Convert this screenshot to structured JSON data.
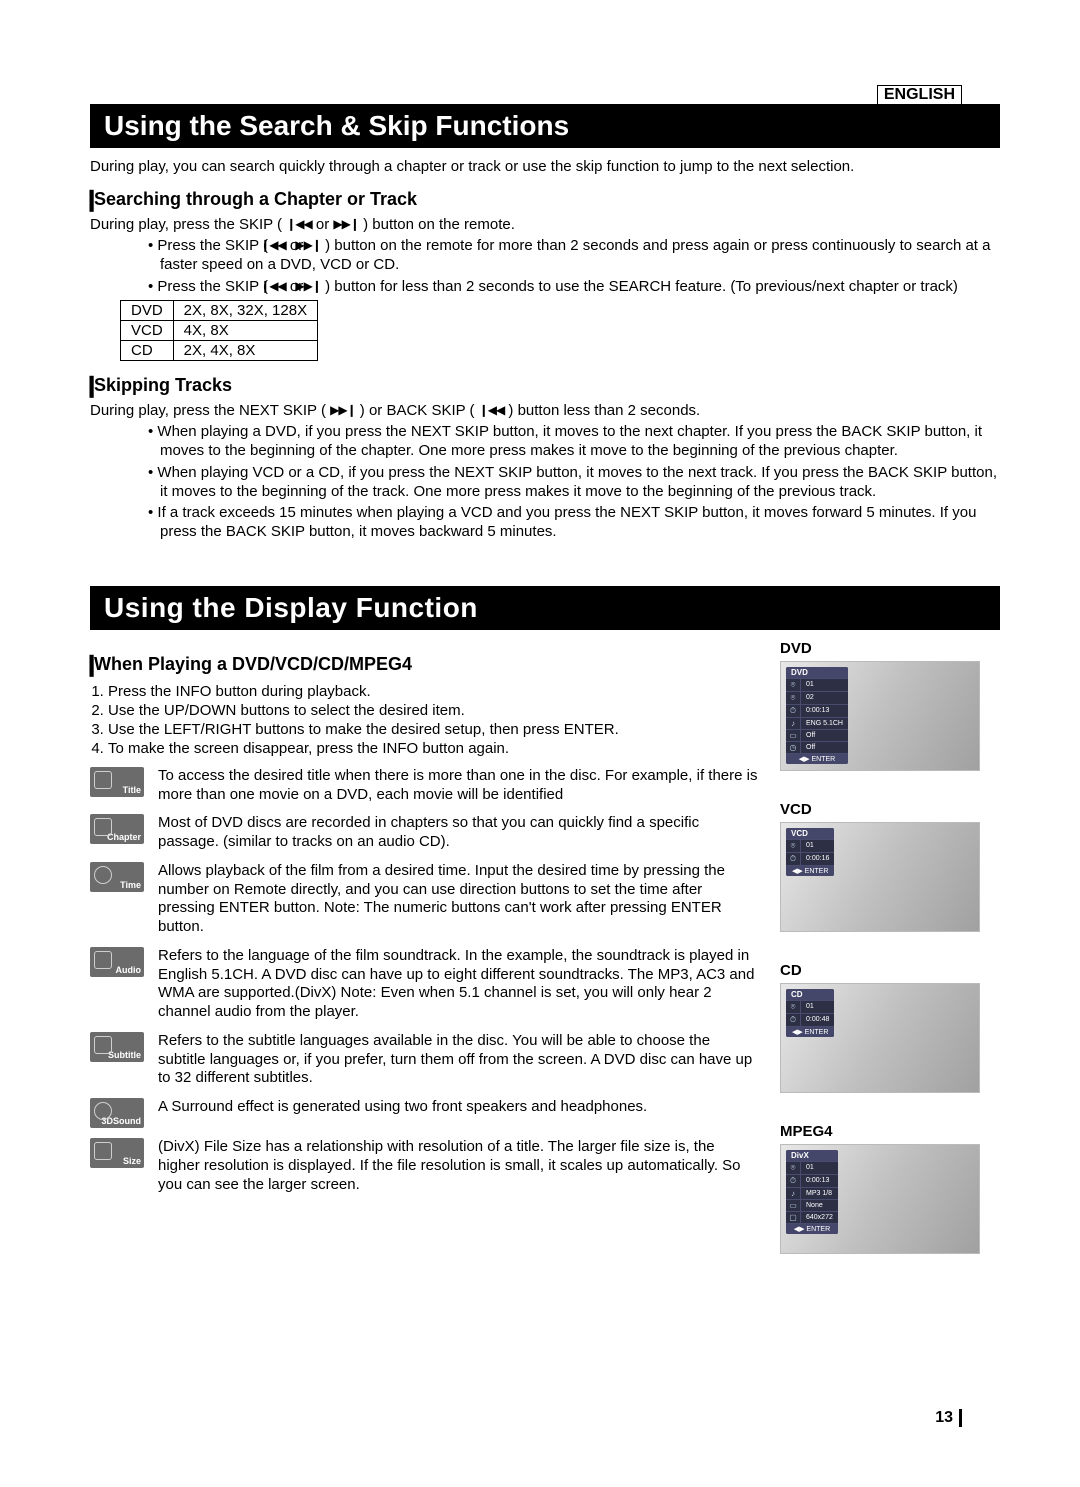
{
  "lang_label": "ENGLISH",
  "page_number": "13",
  "section1": {
    "heading": "Using the Search & Skip Functions",
    "intro": "During play, you can search quickly through a chapter or track or use the skip function to jump to the next selection.",
    "sub1": {
      "heading": "Searching through a Chapter or Track",
      "line": "During play, press the SKIP (",
      "line_mid": " or ",
      "line_end": " ) button on the remote.",
      "bullet1a": "Press the SKIP (",
      "bullet1b": " or ",
      "bullet1c": " ) button on the remote for more than 2 seconds and press again or press continuously to search at a faster speed on a DVD, VCD or CD.",
      "bullet2a": "Press the SKIP (",
      "bullet2b": " or ",
      "bullet2c": " ) button for less than 2 seconds to use the SEARCH feature. (To previous/next chapter or track)",
      "table": [
        [
          "DVD",
          "2X, 8X, 32X, 128X"
        ],
        [
          "VCD",
          "4X, 8X"
        ],
        [
          "CD",
          "2X, 4X, 8X"
        ]
      ]
    },
    "sub2": {
      "heading": "Skipping Tracks",
      "line_a": "During play, press the NEXT SKIP (",
      "line_b": " ) or BACK SKIP (",
      "line_c": " ) button less than 2 seconds.",
      "bullets": [
        "When playing a DVD, if you press the NEXT SKIP button, it moves to the next chapter. If you press the BACK SKIP button, it moves to the beginning of the chapter. One more press makes it move to the beginning of the previous chapter.",
        "When playing VCD or a CD, if you press the NEXT SKIP button, it moves to the next track. If you press the BACK SKIP button, it moves to the beginning of the track. One more press makes it move to the beginning of the previous track.",
        "If a track exceeds 15 minutes when playing a VCD and you press the NEXT SKIP button, it moves forward 5 minutes. If you press the BACK SKIP button, it moves backward 5 minutes."
      ]
    }
  },
  "section2": {
    "heading": "Using the Display Function",
    "sub": {
      "heading": "When Playing a DVD/VCD/CD/MPEG4",
      "steps": [
        "Press the INFO button during playback.",
        "Use the UP/DOWN buttons to select the desired item.",
        "Use the LEFT/RIGHT buttons to make the desired setup, then press ENTER.",
        "To make the screen disappear, press the INFO button again."
      ],
      "defs": [
        {
          "label": "Title",
          "text": "To access the desired title when there is more than one in the disc. For example, if there is more than one movie on a DVD, each movie will be identified"
        },
        {
          "label": "Chapter",
          "text": "Most of DVD discs are recorded in chapters so that you can quickly find a specific passage. (similar to tracks on an audio CD)."
        },
        {
          "label": "Time",
          "text": "Allows playback of the film from a desired time. Input the desired time by pressing the number on Remote directly, and you can use direction buttons to set the time after pressing ENTER button. Note: The numeric buttons can't work after pressing ENTER button."
        },
        {
          "label": "Audio",
          "text": "Refers to the language of the film soundtrack. In the example, the soundtrack is played in English 5.1CH. A DVD disc can have up to eight different soundtracks. The MP3, AC3 and WMA are supported.(DivX) Note: Even when 5.1 channel is set, you will only hear 2 channel audio from the player."
        },
        {
          "label": "Subtitle",
          "text": "Refers to the subtitle languages available in the disc. You will be able to choose the subtitle languages or, if you prefer, turn them off from the screen. A DVD disc can have up to 32 different subtitles."
        },
        {
          "label": "3DSound",
          "text": "A Surround effect is generated using two front speakers and headphones."
        },
        {
          "label": "Size",
          "text": "(DivX) File Size has a relationship with resolution of a title. The larger file size is, the higher resolution is displayed. If the file resolution is small, it scales up automatically. So you can see the larger screen."
        }
      ]
    },
    "osd": {
      "dvd": {
        "title": "DVD",
        "hdr": "DVD",
        "rows": [
          [
            "⌾",
            "01"
          ],
          [
            "⌾",
            "02"
          ],
          [
            "⏱",
            "0:00:13"
          ],
          [
            "♪",
            "ENG 5.1CH"
          ],
          [
            "▭",
            "Off"
          ],
          [
            "◷",
            "Off"
          ]
        ],
        "ft": "◀▶   ENTER"
      },
      "vcd": {
        "title": "VCD",
        "hdr": "VCD",
        "rows": [
          [
            "⌾",
            "01"
          ],
          [
            "⏱",
            "0:00:16"
          ]
        ],
        "ft": "◀▶   ENTER"
      },
      "cd": {
        "title": "CD",
        "hdr": "CD",
        "rows": [
          [
            "⌾",
            "01"
          ],
          [
            "⏱",
            "0:00:48"
          ]
        ],
        "ft": "◀▶   ENTER"
      },
      "mpeg4": {
        "title": "MPEG4",
        "hdr": "DivX",
        "rows": [
          [
            "⌾",
            "01"
          ],
          [
            "⏱",
            "0:00:13"
          ],
          [
            "♪",
            "MP3 1/8"
          ],
          [
            "▭",
            "None"
          ],
          [
            "▢",
            "640x272"
          ]
        ],
        "ft": "◀▶   ENTER"
      }
    }
  },
  "icons": {
    "prev": "❙◀◀",
    "next": "▶▶❙"
  }
}
